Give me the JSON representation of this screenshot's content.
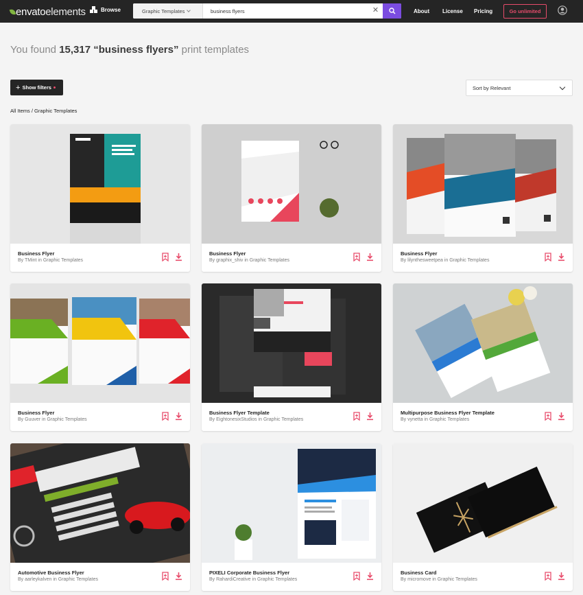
{
  "header": {
    "logo_prefix": "envato",
    "logo_suffix": "elements",
    "browse": "Browse",
    "search_category": "Graphic Templates",
    "search_query": "business flyers",
    "nav": [
      "About",
      "License",
      "Pricing"
    ],
    "cta": "Go unlimited"
  },
  "results": {
    "prefix": "You found",
    "count": "15,317",
    "query": "“business flyers”",
    "suffix": "print templates"
  },
  "filters_label": "Show filters",
  "sort_label": "Sort by Relevant",
  "breadcrumb": "All Items / Graphic Templates",
  "colors": {
    "accent": "#7b4ce0",
    "pink": "#e84c6b",
    "dark": "#252525"
  },
  "cards": [
    {
      "title": "Business Flyer",
      "byline": "By TMint in Graphic Templates"
    },
    {
      "title": "Business Flyer",
      "byline": "By graphix_shiv in Graphic Templates"
    },
    {
      "title": "Business Flyer",
      "byline": "By lilynthesweetpea in Graphic Templates"
    },
    {
      "title": "Business Flyer",
      "byline": "By Guuver in Graphic Templates"
    },
    {
      "title": "Business Flyer Template",
      "byline": "By EightonesixStudios in Graphic Templates"
    },
    {
      "title": "Multipurpose Business Flyer Template",
      "byline": "By vynetta in Graphic Templates"
    },
    {
      "title": "Automotive Business Flyer",
      "byline": "By aarleykalven in Graphic Templates"
    },
    {
      "title": "PIXELI Corporate Business Flyer",
      "byline": "By RahardiCreative in Graphic Templates"
    },
    {
      "title": "Business Card",
      "byline": "By micromove in Graphic Templates"
    }
  ]
}
